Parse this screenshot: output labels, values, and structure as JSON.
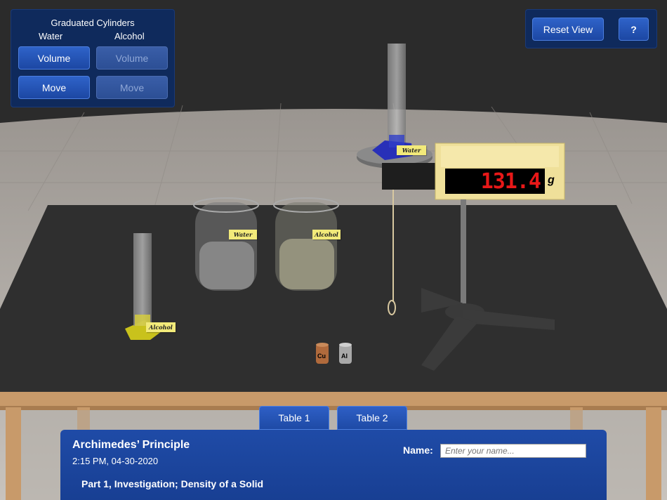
{
  "top_left_panel": {
    "title": "Graduated Cylinders",
    "col_water": "Water",
    "col_alcohol": "Alcohol",
    "water_volume_label": "Volume",
    "alcohol_volume_label": "Volume",
    "water_move_label": "Move",
    "alcohol_move_label": "Move"
  },
  "top_right_panel": {
    "reset_label": "Reset View",
    "help_label": "?"
  },
  "scene": {
    "balance_reading": "131.4",
    "balance_unit": "g",
    "beaker_water_label": "Water",
    "beaker_alcohol_label": "Alcohol",
    "cylinder_water_label": "Water",
    "cylinder_alcohol_label": "Alcohol",
    "sample_cu": "Cu",
    "sample_al": "Al"
  },
  "tabs": [
    "Table 1",
    "Table 2"
  ],
  "bottom_panel": {
    "title": "Archimedes’ Principle",
    "datetime": "2:15 PM, 04-30-2020",
    "name_label": "Name:",
    "name_placeholder": "Enter your name...",
    "name_value": "",
    "section": "Part 1, Investigation; Density of a Solid"
  },
  "colors": {
    "panel_bg": "#0f2a5c",
    "button_blue": "#1c47a3",
    "readout_red": "#e81818",
    "table_top": "#2e2e2e"
  }
}
